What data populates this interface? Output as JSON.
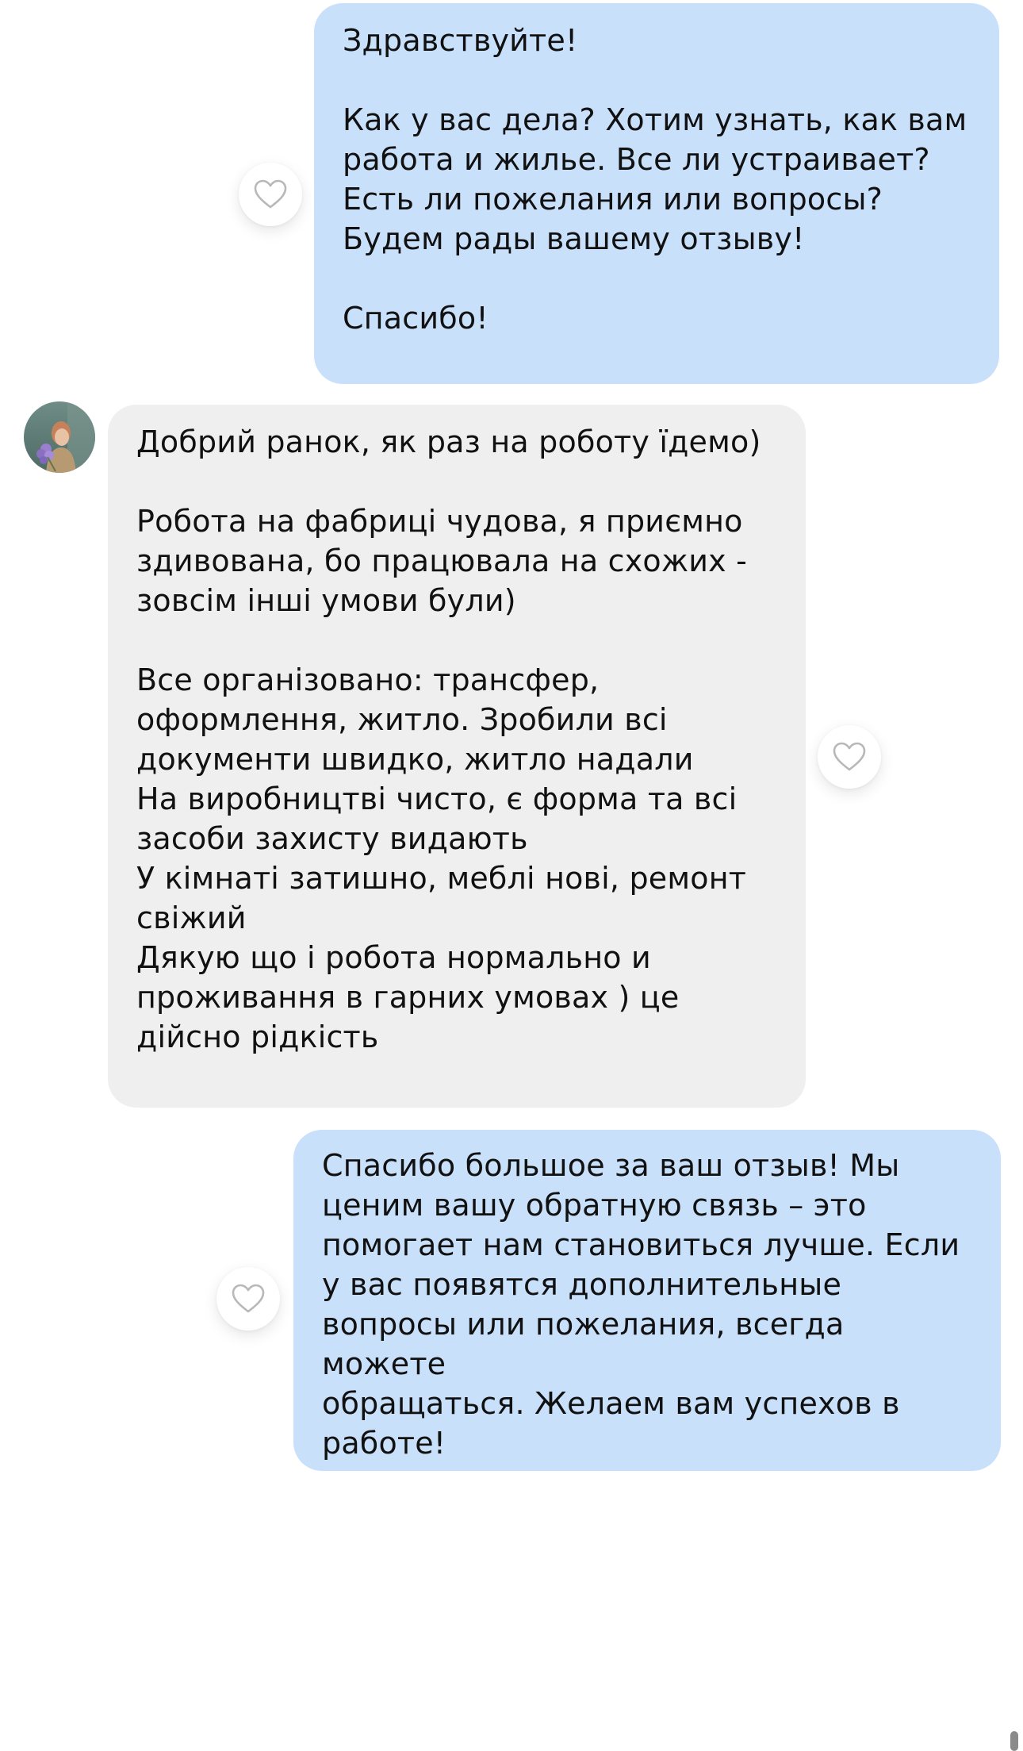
{
  "messages": [
    {
      "direction": "outgoing",
      "paragraphs": [
        "Здравствуйте!",
        "Как у вас дела? Хотим узнать, как вам\nработа и жилье. Все ли устраивает?\nЕсть ли пожелания или вопросы?\nБудем рады вашему отзыву!",
        "Спасибо!"
      ]
    },
    {
      "direction": "incoming",
      "paragraphs": [
        "Добрий ранок, як раз на роботу їдемо)",
        "Робота на фабриці чудова, я  приємно\nздивована, бо працювала на схожих -\nзовсім інші умови були)",
        "Все організовано: трансфер,\nоформлення, житло. Зробили всі\nдокументи швидко, житло надали\nНа виробництві чисто, є форма та всі\nзасоби захисту видають\nУ кімнаті затишно, меблі нові, ремонт\nсвіжий\nДякую що і робота нормально и\nпроживання в гарних умовах ) це\nдійсно рідкість"
      ]
    },
    {
      "direction": "outgoing",
      "paragraphs": [
        "Спасибо большое за ваш отзыв! Мы\nценим вашу обратную связь – это\nпомогает нам становиться лучше. Если\nу вас появятся дополнительные\nвопросы или пожелания, всегда можете\nобращаться. Желаем вам успехов в\nработе!"
      ]
    }
  ],
  "icons": {
    "reaction": "heart-outline-icon",
    "avatar": "contact-avatar"
  },
  "colors": {
    "outgoing_bubble": "#c9e0fb",
    "incoming_bubble": "#efefef",
    "heart_stroke": "#b8b8b8",
    "background": "#ffffff"
  }
}
